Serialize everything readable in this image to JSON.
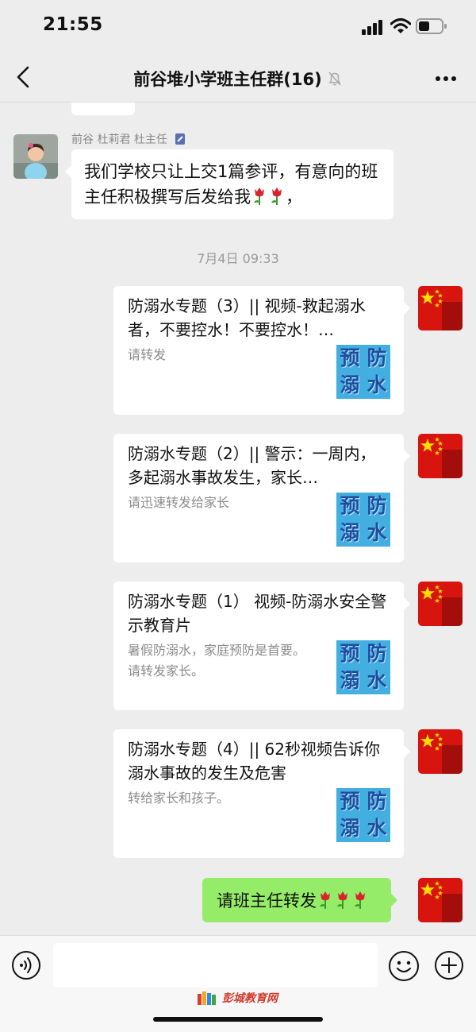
{
  "status": {
    "time": "21:55"
  },
  "header": {
    "title": "前谷堆小学班主任群(16)"
  },
  "incoming": {
    "sender_name": "前谷 杜莉君 杜主任",
    "text": "我们学校只让上交1篇参评，有意向的班主任积极撰写后发给我"
  },
  "timestamp": "7月4日 09:33",
  "thumb_text": [
    "预",
    "防",
    "溺",
    "水"
  ],
  "cards": [
    {
      "title": "防溺水专题（3）|| 视频-救起溺水者，不要控水！不要控水！…",
      "desc": "请转发"
    },
    {
      "title": "防溺水专题（2）|| 警示：一周内，多起溺水事故发生，家长…",
      "desc": "请迅速转发给家长"
    },
    {
      "title": "防溺水专题（1）  视频-防溺水安全警示教育片",
      "desc": "暑假防溺水，家庭预防是首要。请转发家长。"
    },
    {
      "title": "防溺水专题（4）|| 62秒视频告诉你溺水事故的发生及危害",
      "desc": "转给家长和孩子。"
    }
  ],
  "outgoing": {
    "text": "请班主任转发"
  },
  "input": {
    "placeholder": ""
  },
  "watermark": "彭城教育网",
  "colors": {
    "bg": "#ededed",
    "sent_bubble": "#95ec69",
    "flag_red": "#d8140f",
    "thumb_blue": "#43aee0"
  }
}
